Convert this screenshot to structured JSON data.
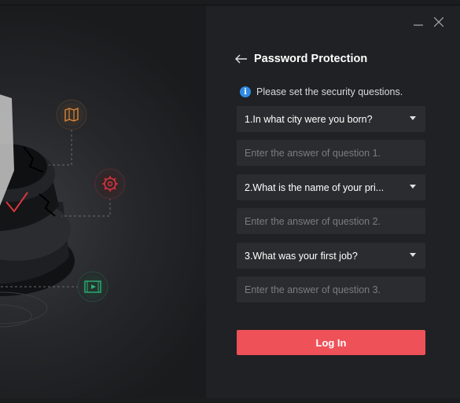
{
  "window": {
    "minimize_icon": "minimize-icon",
    "close_icon": "close-icon"
  },
  "header": {
    "title": "Password Protection",
    "back_icon": "arrow-left-icon"
  },
  "notice": {
    "text": "Please set the security questions.",
    "icon": "info-icon"
  },
  "questions": [
    {
      "selected": "1.In what city were you born?",
      "answer_placeholder": "Enter the answer of question 1."
    },
    {
      "selected": "2.What is the name of your pri...",
      "answer_placeholder": "Enter the answer of question 2."
    },
    {
      "selected": "3.What was your first job?",
      "answer_placeholder": "Enter the answer of question 3."
    }
  ],
  "login_button": "Log In",
  "colors": {
    "accent": "#ef5158",
    "info": "#2f8be6",
    "icon_map": "#d8863a",
    "icon_gear": "#d9363e",
    "icon_video": "#2fae7a"
  }
}
